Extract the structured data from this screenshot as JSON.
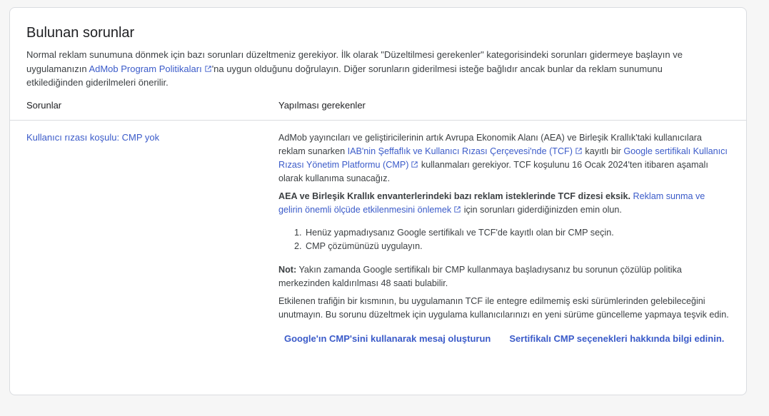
{
  "page": {
    "title": "Bulunan sorunlar",
    "description": {
      "part1": "Normal reklam sunumuna dönmek için bazı sorunları düzeltmeniz gerekiyor. İlk olarak \"Düzeltilmesi gerekenler\" kategorisindeki sorunları gidermeye başlayın ve uygulamanızın ",
      "link": "AdMob Program Politikaları",
      "part2": "'na uygun olduğunu doğrulayın. Diğer sorunların giderilmesi isteğe bağlıdır ancak bunlar da reklam sunumunu etkilediğinden giderilmeleri önerilir."
    }
  },
  "table": {
    "col_issues": "Sorunlar",
    "col_actions": "Yapılması gerekenler"
  },
  "issue": {
    "title": "Kullanıcı rızası koşulu: CMP yok",
    "p1": {
      "part1": "AdMob yayıncıları ve geliştiricilerinin artık Avrupa Ekonomik Alanı (AEA) ve Birleşik Krallık'taki kullanıcılara reklam sunarken ",
      "link1": "IAB'nin Şeffaflık ve Kullanıcı Rızası Çerçevesi'nde (TCF)",
      "part2": " kayıtlı bir ",
      "link2": "Google sertifikalı Kullanıcı Rızası Yönetim Platformu (CMP)",
      "part3": " kullanmaları gerekiyor. TCF koşulunu 16 Ocak 2024'ten itibaren aşamalı olarak kullanıma sunacağız."
    },
    "p2": {
      "bold": "AEA ve Birleşik Krallık envanterlerindeki bazı reklam isteklerinde TCF dizesi eksik.",
      "link": "Reklam sunma ve gelirin önemli ölçüde etkilenmesini önlemek",
      "part2": " için sorunları giderdiğinizden emin olun."
    },
    "steps": [
      "Henüz yapmadıysanız Google sertifikalı ve TCF'de kayıtlı olan bir CMP seçin.",
      "CMP çözümünüzü uygulayın."
    ],
    "note": {
      "label": "Not:",
      "text": " Yakın zamanda Google sertifikalı bir CMP kullanmaya başladıysanız bu sorunun çözülüp politika merkezinden kaldırılması 48 saati bulabilir."
    },
    "p4": "Etkilenen trafiğin bir kısmının, bu uygulamanın TCF ile entegre edilmemiş eski sürümlerinden gelebileceğini unutmayın. Bu sorunu düzeltmek için uygulama kullanıcılarınızı en yeni sürüme güncelleme yapmaya teşvik edin.",
    "buttons": {
      "create_message": "Google'ın CMP'sini kullanarak mesaj oluşturun",
      "learn_more": "Sertifikalı CMP seçenekleri hakkında bilgi edinin."
    }
  },
  "colors": {
    "link": "#3b5bc9",
    "text": "#3c4043",
    "border": "#dadce0",
    "background": "#f6f6f6"
  },
  "icons": [
    "external-link-icon"
  ]
}
